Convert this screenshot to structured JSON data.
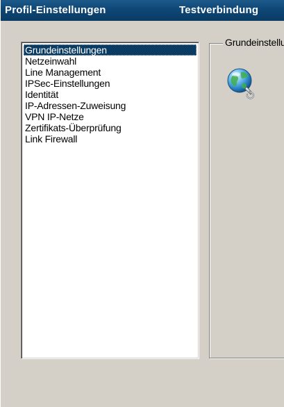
{
  "title_bar": {
    "items": [
      {
        "label": "Profil-Einstellungen"
      },
      {
        "label": "Testverbindung"
      }
    ],
    "color": "#0a3b63"
  },
  "profile_list": {
    "selected_index": 0,
    "items": [
      {
        "label": "Grundeinstellungen"
      },
      {
        "label": "Netzeinwahl"
      },
      {
        "label": "Line Management"
      },
      {
        "label": "IPSec-Einstellungen"
      },
      {
        "label": "Identität"
      },
      {
        "label": "IP-Adressen-Zuweisung"
      },
      {
        "label": "VPN IP-Netze"
      },
      {
        "label": "Zertifikats-Überprüfung"
      },
      {
        "label": "Link Firewall"
      }
    ]
  },
  "group": {
    "label": "Grundeinstellungen",
    "icon": "globe-network-icon"
  }
}
